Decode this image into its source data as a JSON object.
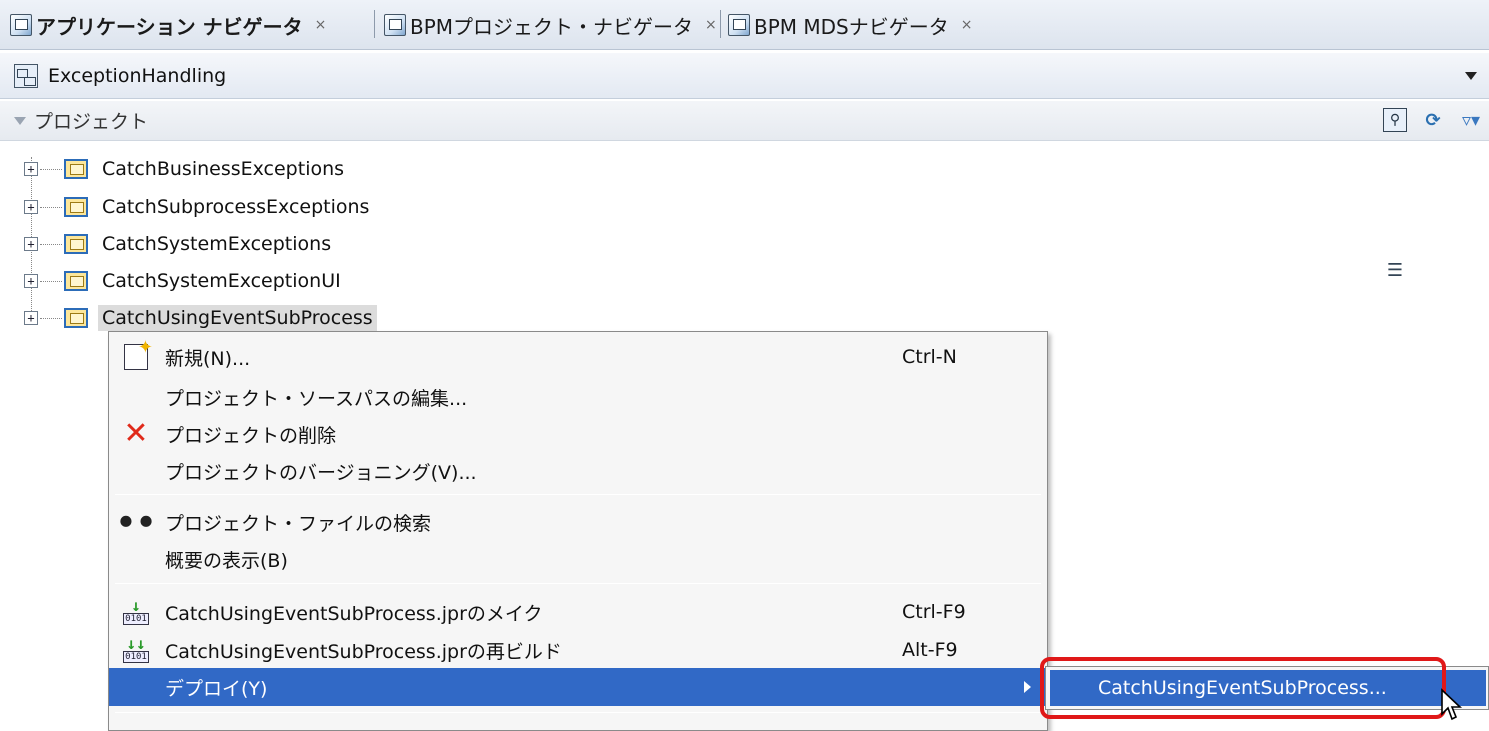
{
  "tabs": [
    {
      "label": "アプリケーション ナビゲータ",
      "close": "×",
      "active": true
    },
    {
      "label": "BPMプロジェクト・ナビゲータ",
      "close": "×",
      "active": false
    },
    {
      "label": "BPM MDSナビゲータ",
      "close": "×",
      "active": false
    }
  ],
  "application": {
    "name": "ExceptionHandling"
  },
  "projects_panel": {
    "title": "プロジェクト"
  },
  "tree": {
    "expander_glyph": "+",
    "items": [
      {
        "label": "CatchBusinessExceptions"
      },
      {
        "label": "CatchSubprocessExceptions"
      },
      {
        "label": "CatchSystemExceptions"
      },
      {
        "label": "CatchSystemExceptionUI"
      },
      {
        "label": "CatchUsingEventSubProcess",
        "selected": true
      }
    ]
  },
  "context_menu": {
    "items": [
      {
        "label": "新規(N)...",
        "shortcut": "Ctrl-N",
        "icon": "new-icon"
      },
      {
        "label": "プロジェクト・ソースパスの編集...",
        "shortcut": ""
      },
      {
        "label": "プロジェクトの削除",
        "shortcut": "",
        "icon": "delete-icon"
      },
      {
        "label": "プロジェクトのバージョニング(V)...",
        "shortcut": ""
      },
      {
        "label": "プロジェクト・ファイルの検索",
        "shortcut": "",
        "icon": "binoculars-icon"
      },
      {
        "label": "概要の表示(B)",
        "shortcut": ""
      },
      {
        "label": "CatchUsingEventSubProcess.jprのメイク",
        "shortcut": "Ctrl-F9",
        "icon": "make-icon"
      },
      {
        "label": "CatchUsingEventSubProcess.jprの再ビルド",
        "shortcut": "Alt-F9",
        "icon": "rebuild-icon"
      },
      {
        "label": "デプロイ(Y)",
        "shortcut": "",
        "highlighted": true,
        "has_submenu": true
      }
    ]
  },
  "deploy_submenu": {
    "items": [
      {
        "label": "CatchUsingEventSubProcess..."
      }
    ]
  },
  "colors": {
    "highlight": "#3169c6",
    "callout": "#e01818",
    "folder": "#fde79a"
  }
}
